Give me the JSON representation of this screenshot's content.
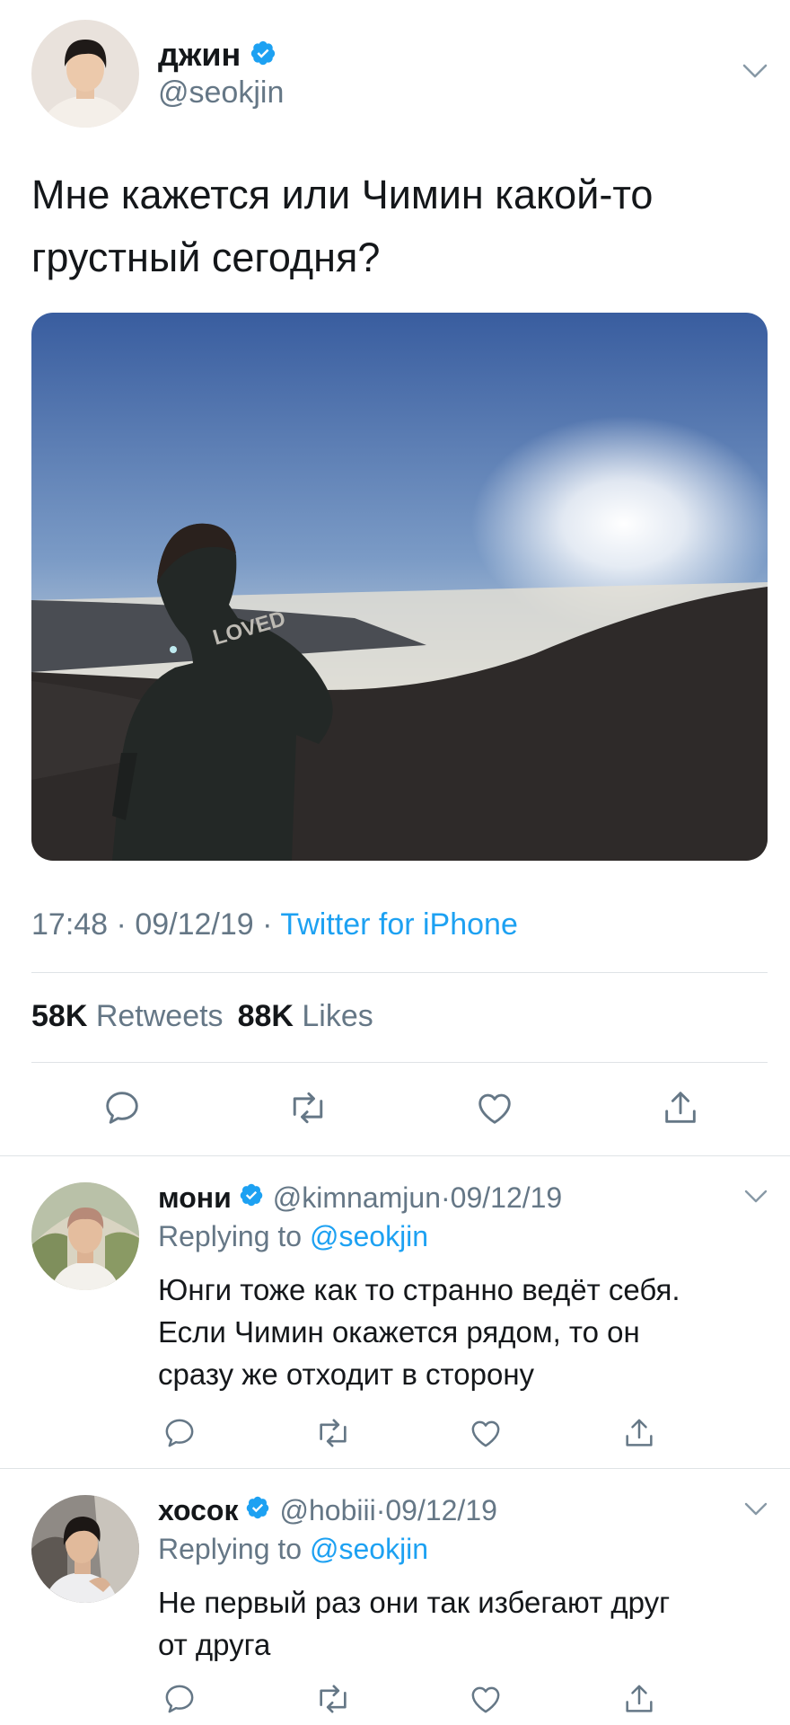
{
  "tweet": {
    "author_name": "джин",
    "author_handle": "@seokjin",
    "text_line1": "Мне кажется или Чимин какой-то",
    "text_line2": "грустный сегодня?",
    "photo_text": "LOVED",
    "time": "17:48",
    "date": "09/12/19",
    "source": "Twitter for iPhone",
    "retweets_count": "58K",
    "retweets_label": "Retweets",
    "likes_count": "88K",
    "likes_label": "Likes",
    "dot": "·"
  },
  "replies": [
    {
      "name": "мони",
      "handle": "@kimnamjun",
      "date": "09/12/19",
      "replying_prefix": "Replying to",
      "replying_to": "@seokjin",
      "line1": "Юнги тоже как то странно ведёт себя.",
      "line2": "Если Чимин окажется рядом, то он",
      "line3": "сразу же отходит в сторону"
    },
    {
      "name": "хосок",
      "handle": "@hobiii",
      "date": "09/12/19",
      "replying_prefix": "Replying to",
      "replying_to": "@seokjin",
      "line1": "Не первый раз они так избегают друг",
      "line2": "от друга"
    }
  ],
  "colors": {
    "accent": "#1da1f2",
    "secondary_text": "#657786",
    "primary_text": "#14171a",
    "divider": "#dfe3e6"
  },
  "icons": [
    "verified-badge-icon",
    "chevron-down-icon",
    "reply-icon",
    "retweet-icon",
    "like-icon",
    "share-icon"
  ]
}
